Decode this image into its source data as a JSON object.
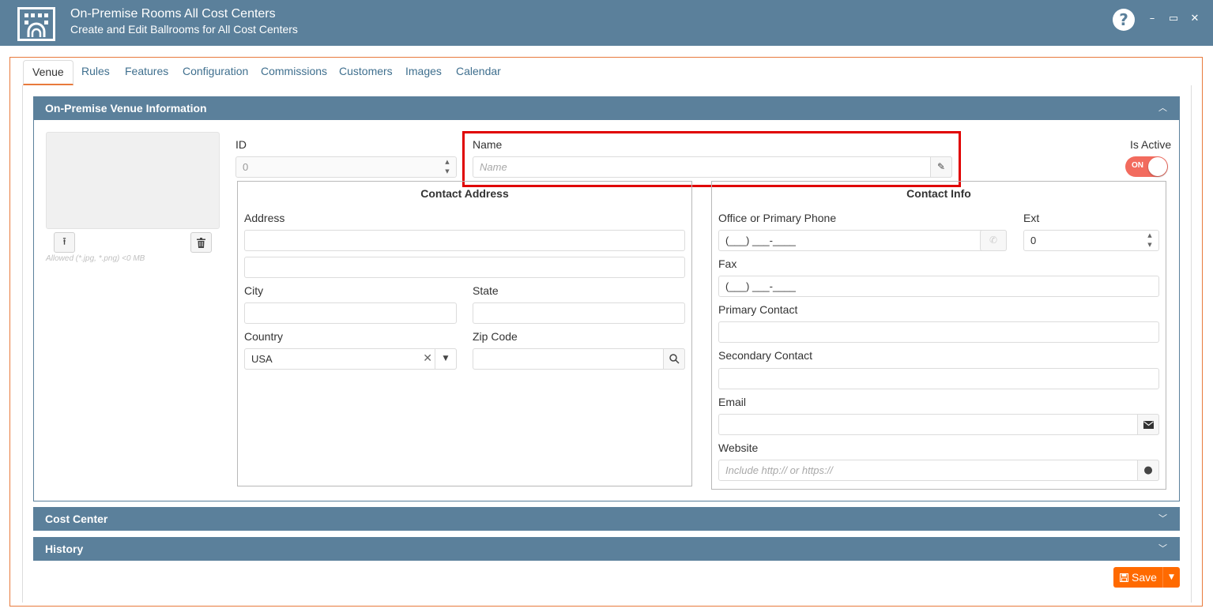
{
  "header": {
    "title": "On-Premise Rooms All Cost Centers",
    "subtitle": "Create and Edit Ballrooms for All Cost Centers",
    "help": "?",
    "minimize": "–",
    "maximize": "▭",
    "close": "✕"
  },
  "tabs": [
    {
      "label": "Venue"
    },
    {
      "label": "Rules"
    },
    {
      "label": "Features"
    },
    {
      "label": "Configuration"
    },
    {
      "label": "Commissions"
    },
    {
      "label": "Customers"
    },
    {
      "label": "Images"
    },
    {
      "label": "Calendar"
    }
  ],
  "venue_section": {
    "title": "On-Premise Venue Information",
    "allowed_note": "Allowed (*.jpg, *.png) <0 MB",
    "id_label": "ID",
    "id_value": "0",
    "name_label": "Name",
    "name_placeholder": "Name",
    "is_active_label": "Is Active",
    "toggle_text": "ON"
  },
  "contact_address": {
    "title": "Contact Address",
    "address_label": "Address",
    "city_label": "City",
    "state_label": "State",
    "country_label": "Country",
    "country_value": "USA",
    "zip_label": "Zip Code"
  },
  "contact_info": {
    "title": "Contact Info",
    "phone_label": "Office or Primary Phone",
    "phone_mask": "(___) ___-____",
    "ext_label": "Ext",
    "ext_value": "0",
    "fax_label": "Fax",
    "fax_mask": "(___) ___-____",
    "primary_contact_label": "Primary Contact",
    "secondary_contact_label": "Secondary Contact",
    "email_label": "Email",
    "website_label": "Website",
    "website_placeholder": "Include http:// or https://"
  },
  "sections": {
    "cost_center": "Cost Center",
    "history": "History"
  },
  "footer": {
    "save_label": "Save"
  },
  "colors": {
    "header_bg": "#5b809b",
    "accent": "#e87a3c",
    "save": "#ff6a00",
    "toggle_on": "#f26b5e",
    "highlight": "#e00000"
  }
}
